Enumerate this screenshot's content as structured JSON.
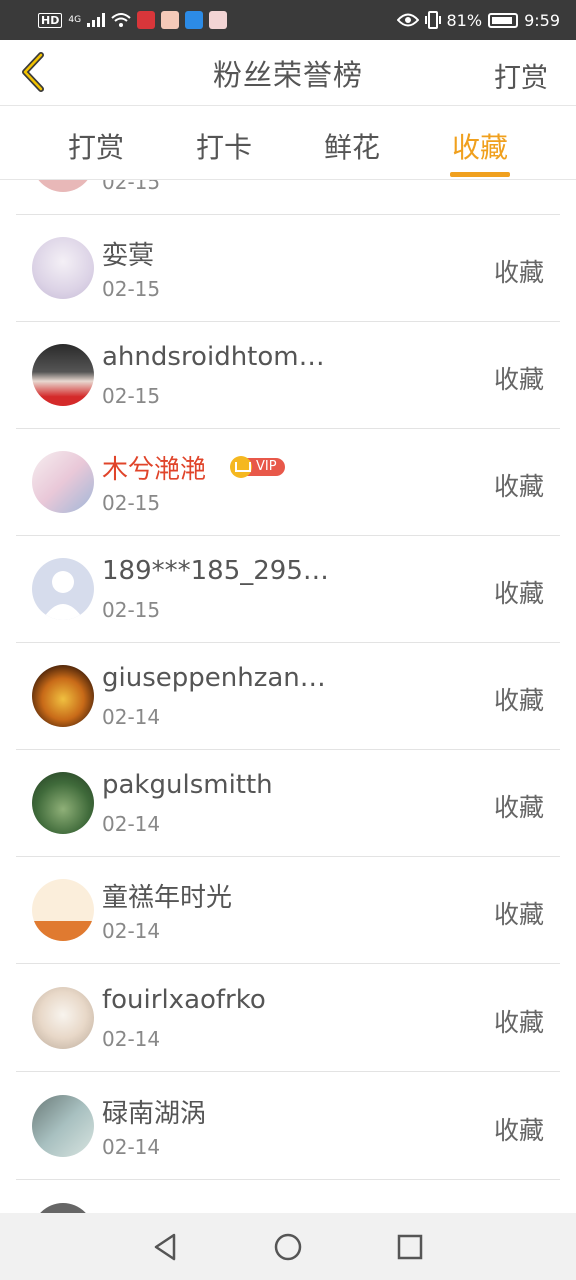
{
  "status_bar": {
    "left_hd": "HD",
    "left_network": "4G",
    "battery_percent": "81%",
    "time": "9:59"
  },
  "header": {
    "title": "粉丝荣誉榜",
    "right_action": "打赏"
  },
  "tabs": [
    {
      "label": "打赏",
      "active": false
    },
    {
      "label": "打卡",
      "active": false
    },
    {
      "label": "鲜花",
      "active": false
    },
    {
      "label": "收藏",
      "active": true
    }
  ],
  "list": {
    "partial_top": {
      "date": "02-15"
    },
    "rows": [
      {
        "name": "娈蓂",
        "date": "02-15",
        "action": "收藏",
        "vip": false
      },
      {
        "name": "ahndsroidhtom…",
        "date": "02-15",
        "action": "收藏",
        "vip": false
      },
      {
        "name": "木兮滟滟",
        "date": "02-15",
        "action": "收藏",
        "vip": true,
        "vip_label": "VIP"
      },
      {
        "name": "189***185_295…",
        "date": "02-15",
        "action": "收藏",
        "vip": false
      },
      {
        "name": "giuseppenhzan…",
        "date": "02-14",
        "action": "收藏",
        "vip": false
      },
      {
        "name": "pakgulsmitth",
        "date": "02-14",
        "action": "收藏",
        "vip": false
      },
      {
        "name": "童禚年时光",
        "date": "02-14",
        "action": "收藏",
        "vip": false
      },
      {
        "name": "fouirlxaofrko",
        "date": "02-14",
        "action": "收藏",
        "vip": false
      },
      {
        "name": "碌南湖涡",
        "date": "02-14",
        "action": "收藏",
        "vip": false
      }
    ]
  },
  "colors": {
    "accent": "#f0a01e",
    "vip_name": "#e0442a",
    "vip_badge": "#e8584a",
    "status_bar": "#3a3a3a"
  },
  "nav": {
    "icons": [
      "back-triangle-icon",
      "home-circle-icon",
      "recents-square-icon"
    ]
  }
}
